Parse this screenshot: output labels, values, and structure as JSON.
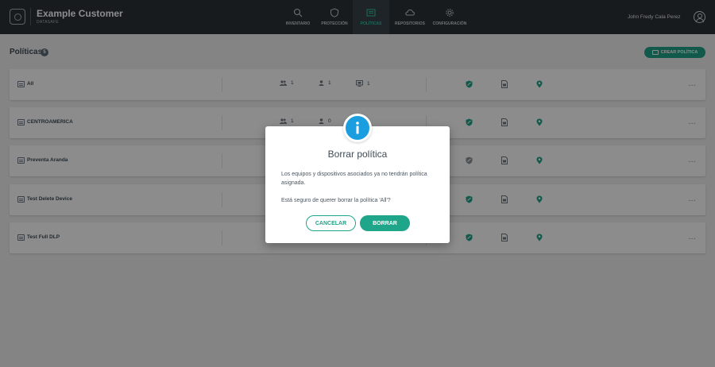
{
  "app": {
    "title": "Example Customer",
    "subtitle": "DATASAFE"
  },
  "nav": {
    "items": [
      {
        "label": "INVENTARIO",
        "icon": "search-icon",
        "active": false
      },
      {
        "label": "PROTECCIÓN",
        "icon": "shield-icon",
        "active": false
      },
      {
        "label": "POLÍTICAS",
        "icon": "policies-icon",
        "active": true
      },
      {
        "label": "REPOSITORIOS",
        "icon": "cloud-icon",
        "active": false
      },
      {
        "label": "CONFIGURACIÓN",
        "icon": "gear-icon",
        "active": false
      }
    ]
  },
  "user": {
    "name": "John Fredy Cala Perez"
  },
  "page": {
    "title": "Políticas",
    "count": "5",
    "create_button": "CREAR POLÍTICA"
  },
  "policies": [
    {
      "name": "All",
      "groups": "1",
      "users": "1",
      "devices": "1"
    },
    {
      "name": "CENTROAMERICA",
      "groups": "1",
      "users": "0",
      "devices": ""
    },
    {
      "name": "Preventa Aranda",
      "groups": "",
      "users": "",
      "devices": ""
    },
    {
      "name": "Test Delete Device",
      "groups": "",
      "users": "",
      "devices": ""
    },
    {
      "name": "Test Full DLP",
      "groups": "",
      "users": "",
      "devices": ""
    }
  ],
  "modal": {
    "icon": "info-icon",
    "title": "Borrar política",
    "message": "Los equipos y dispositivos asociados ya no tendrán política asignada.",
    "confirm": "Está seguro de querer borrar la política 'All'?",
    "cancel_label": "CANCELAR",
    "delete_label": "BORRAR"
  },
  "colors": {
    "topbar": "#2b3238",
    "accent": "#1fa589",
    "info": "#1a9ee0"
  }
}
